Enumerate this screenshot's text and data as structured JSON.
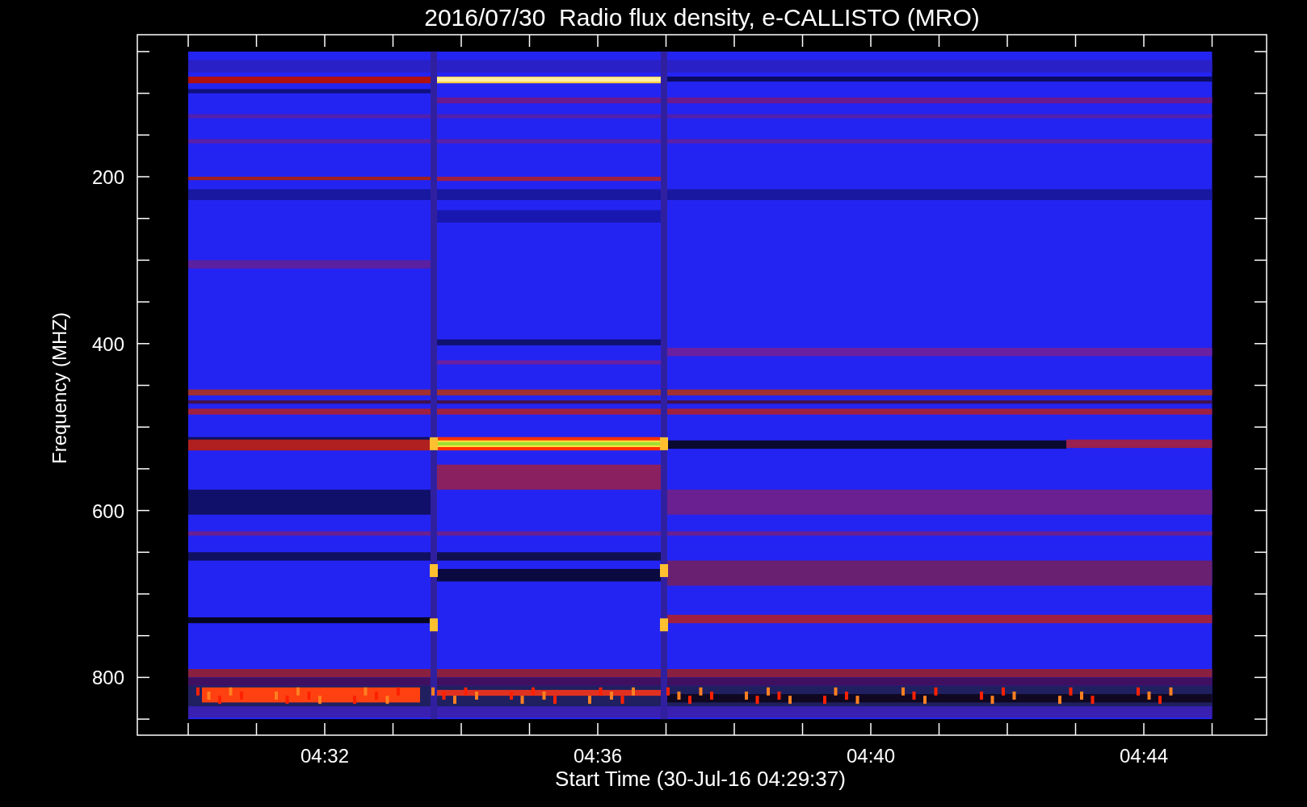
{
  "title": "2016/07/30  Radio flux density, e-CALLISTO (MRO)",
  "y_axis": {
    "label": "Frequency (MHZ)",
    "ticks": [
      "200",
      "400",
      "600",
      "800"
    ]
  },
  "x_axis": {
    "label": "Start Time (30-Jul-16 04:29:37)",
    "ticks": [
      "04:32",
      "04:36",
      "04:40",
      "04:44"
    ]
  }
}
